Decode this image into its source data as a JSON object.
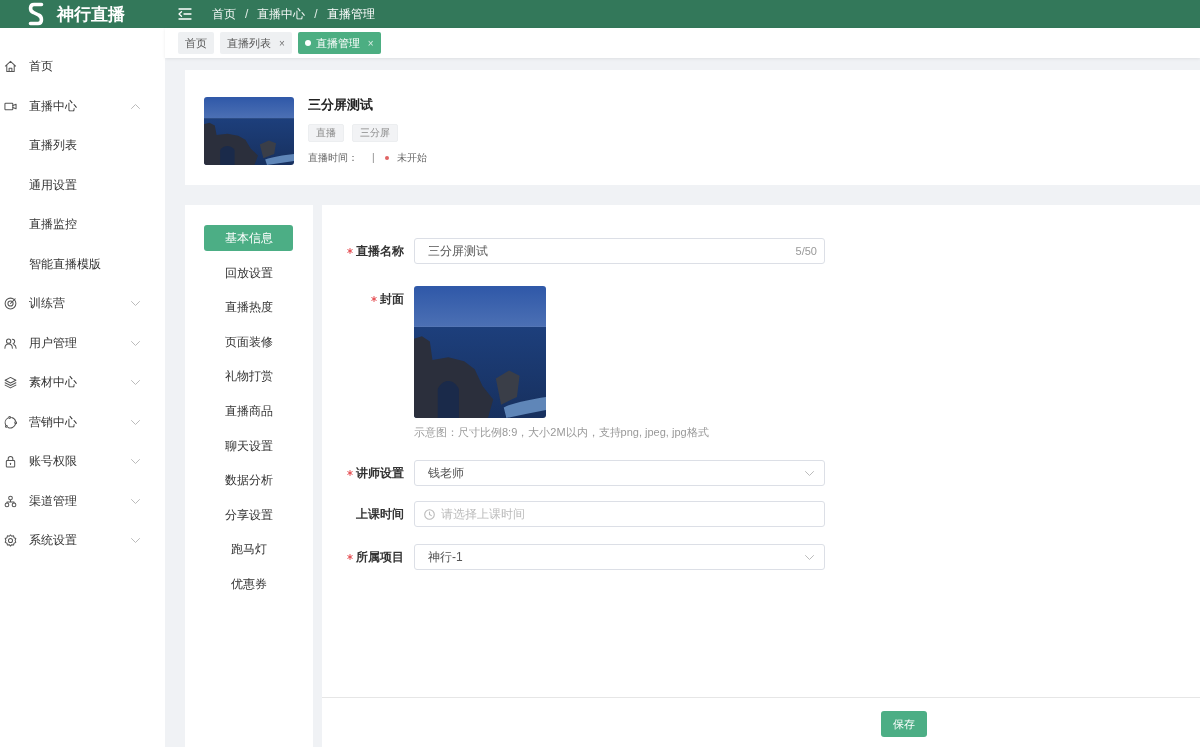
{
  "app": {
    "name": "神行直播"
  },
  "breadcrumb": [
    {
      "kind": "link",
      "text": "首页"
    },
    {
      "kind": "separator",
      "text": "/"
    },
    {
      "kind": "link",
      "text": "直播中心"
    },
    {
      "kind": "separator",
      "text": "/"
    },
    {
      "kind": "current",
      "text": "直播管理"
    }
  ],
  "tabs": [
    {
      "label": "首页",
      "selected": false
    },
    {
      "label": "直播列表",
      "close": "×",
      "selected": false
    },
    {
      "label": "直播管理",
      "close": "×",
      "selected": true
    }
  ],
  "sidebar": {
    "items": [
      {
        "label": "首页"
      },
      {
        "label": "直播中心",
        "expanded": true,
        "children": [
          {
            "label": "直播列表"
          },
          {
            "label": "通用设置"
          },
          {
            "label": "直播监控"
          },
          {
            "label": "智能直播模版"
          }
        ]
      },
      {
        "label": "训练营",
        "expanded": false
      },
      {
        "label": "用户管理",
        "expanded": false
      },
      {
        "label": "素材中心",
        "expanded": false
      },
      {
        "label": "营销中心",
        "expanded": false
      },
      {
        "label": "账号权限",
        "expanded": false
      },
      {
        "label": "渠道管理",
        "expanded": false
      },
      {
        "label": "系统设置",
        "expanded": false
      }
    ]
  },
  "live": {
    "title": "三分屏测试",
    "tags": [
      "直播",
      "三分屏"
    ],
    "time_label": "直播时间：",
    "separator": "|",
    "status": "未开始"
  },
  "settings_menu": [
    {
      "label": "基本信息",
      "selected": true
    },
    {
      "label": "回放设置",
      "selected": false
    },
    {
      "label": "直播热度",
      "selected": false
    },
    {
      "label": "页面装修",
      "selected": false
    },
    {
      "label": "礼物打赏",
      "selected": false
    },
    {
      "label": "直播商品",
      "selected": false
    },
    {
      "label": "聊天设置",
      "selected": false
    },
    {
      "label": "数据分析",
      "selected": false
    },
    {
      "label": "分享设置",
      "selected": false
    },
    {
      "label": "跑马灯",
      "selected": false
    },
    {
      "label": "优惠券",
      "selected": false
    }
  ],
  "form": {
    "fields": [
      {
        "kind": "text",
        "label": "直播名称",
        "required": true,
        "value": "三分屏测试",
        "counter": "5/50"
      },
      {
        "kind": "image",
        "label": "封面",
        "required": true,
        "hint": "示意图：尺寸比例8:9，大小2M以内，支持png, jpeg, jpg格式"
      },
      {
        "kind": "select",
        "label": "讲师设置",
        "required": true,
        "value": "钱老师"
      },
      {
        "kind": "datetime",
        "label": "上课时间",
        "required": false,
        "placeholder": "请选择上课时间"
      },
      {
        "kind": "select",
        "label": "所属项目",
        "required": true,
        "value": "神行-1"
      }
    ],
    "save_button": "保存"
  }
}
